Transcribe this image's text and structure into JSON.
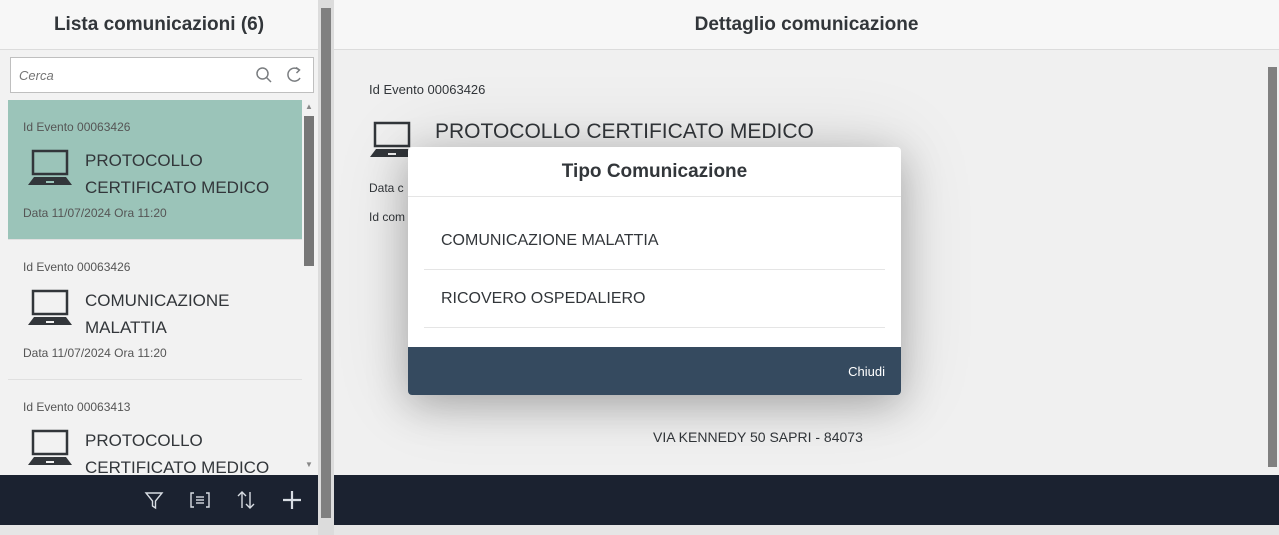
{
  "master": {
    "title": "Lista comunicazioni (6)",
    "search": {
      "placeholder": "Cerca",
      "value": ""
    },
    "items": [
      {
        "event": "Id Evento 00063426",
        "title": "PROTOCOLLO CERTIFICATO MEDICO",
        "date": "Data 11/07/2024 Ora 11:20",
        "selected": true
      },
      {
        "event": "Id Evento 00063426",
        "title": "COMUNICAZIONE MALATTIA",
        "date": "Data 11/07/2024 Ora 11:20",
        "selected": false
      },
      {
        "event": "Id Evento 00063413",
        "title": "PROTOCOLLO CERTIFICATO MEDICO",
        "date": "",
        "selected": false
      }
    ],
    "footer_icons": [
      "filter-icon",
      "group-icon",
      "sort-icon",
      "add-icon"
    ]
  },
  "detail": {
    "title": "Dettaglio comunicazione",
    "event": "Id Evento 00063426",
    "heading": "PROTOCOLLO CERTIFICATO MEDICO",
    "date_partial": "Data c",
    "id_partial": "Id com",
    "address": "VIA KENNEDY 50 SAPRI - 84073"
  },
  "dialog": {
    "title": "Tipo Comunicazione",
    "options": [
      "COMUNICAZIONE MALATTIA",
      "RICOVERO OSPEDALIERO"
    ],
    "close_label": "Chiudi"
  },
  "colors": {
    "selected_row": "#9bc4b9",
    "footer_bar": "#1b2230",
    "dialog_footer": "#354a5f"
  }
}
